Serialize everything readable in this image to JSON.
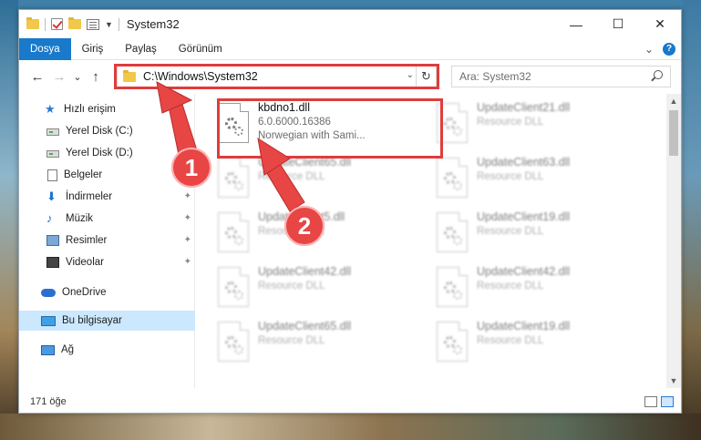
{
  "window": {
    "title": "System32",
    "controls": [
      "—",
      "☐",
      "✕"
    ]
  },
  "ribbon": {
    "tabs": [
      "Dosya",
      "Giriş",
      "Paylaş",
      "Görünüm"
    ],
    "active": "Dosya",
    "expand_glyph": "⌄",
    "help_glyph": "?"
  },
  "nav": {
    "back_glyph": "←",
    "forward_glyph": "→",
    "recent_glyph": "⌄",
    "up_glyph": "↑",
    "address": "C:\\Windows\\System32",
    "address_dropdown_glyph": "⌄",
    "refresh_glyph": "↻",
    "search_placeholder": "Ara: System32"
  },
  "sidebar": {
    "items": [
      {
        "label": "Hızlı erişim",
        "icon": "star-icon"
      },
      {
        "label": "Yerel Disk (C:)",
        "icon": "drive-icon",
        "pinned": true
      },
      {
        "label": "Yerel Disk (D:)",
        "icon": "drive-icon"
      },
      {
        "label": "Belgeler",
        "icon": "document-icon"
      },
      {
        "label": "İndirmeler",
        "icon": "download-icon",
        "pinned": true
      },
      {
        "label": "Müzik",
        "icon": "music-icon",
        "pinned": true
      },
      {
        "label": "Resimler",
        "icon": "pictures-icon",
        "pinned": true
      },
      {
        "label": "Videolar",
        "icon": "video-icon",
        "pinned": true
      },
      {
        "label": "OneDrive",
        "icon": "onedrive-icon"
      },
      {
        "label": "Bu bilgisayar",
        "icon": "pc-icon",
        "selected": true
      },
      {
        "label": "Ağ",
        "icon": "network-icon"
      }
    ],
    "pin_glyph": "📌"
  },
  "files": {
    "highlighted": {
      "name": "kbdno1.dll",
      "version": "6.0.6000.16386",
      "description": "Norwegian with Sami..."
    },
    "others": [
      {
        "name": "UpdateClient21.dll",
        "type": "Resource DLL"
      },
      {
        "name": "UpdateClient65.dll",
        "type": "Resource DLL"
      },
      {
        "name": "UpdateClient63.dll",
        "type": "Resource DLL"
      },
      {
        "name": "UpdateClient5.dll",
        "type": "Resource DLL"
      },
      {
        "name": "UpdateClient19.dll",
        "type": "Resource DLL"
      },
      {
        "name": "UpdateClient42.dll",
        "type": "Resource DLL"
      },
      {
        "name": "UpdateClient42.dll",
        "type": "Resource DLL"
      },
      {
        "name": "UpdateClient65.dll",
        "type": "Resource DLL"
      },
      {
        "name": "UpdateClient19.dll",
        "type": "Resource DLL"
      }
    ]
  },
  "status": {
    "item_count": "171 öğe"
  },
  "callouts": {
    "step1": "1",
    "step2": "2"
  },
  "colors": {
    "accent": "#1979ca",
    "highlight": "#e03c3c",
    "selected_bg": "#cce8ff"
  }
}
